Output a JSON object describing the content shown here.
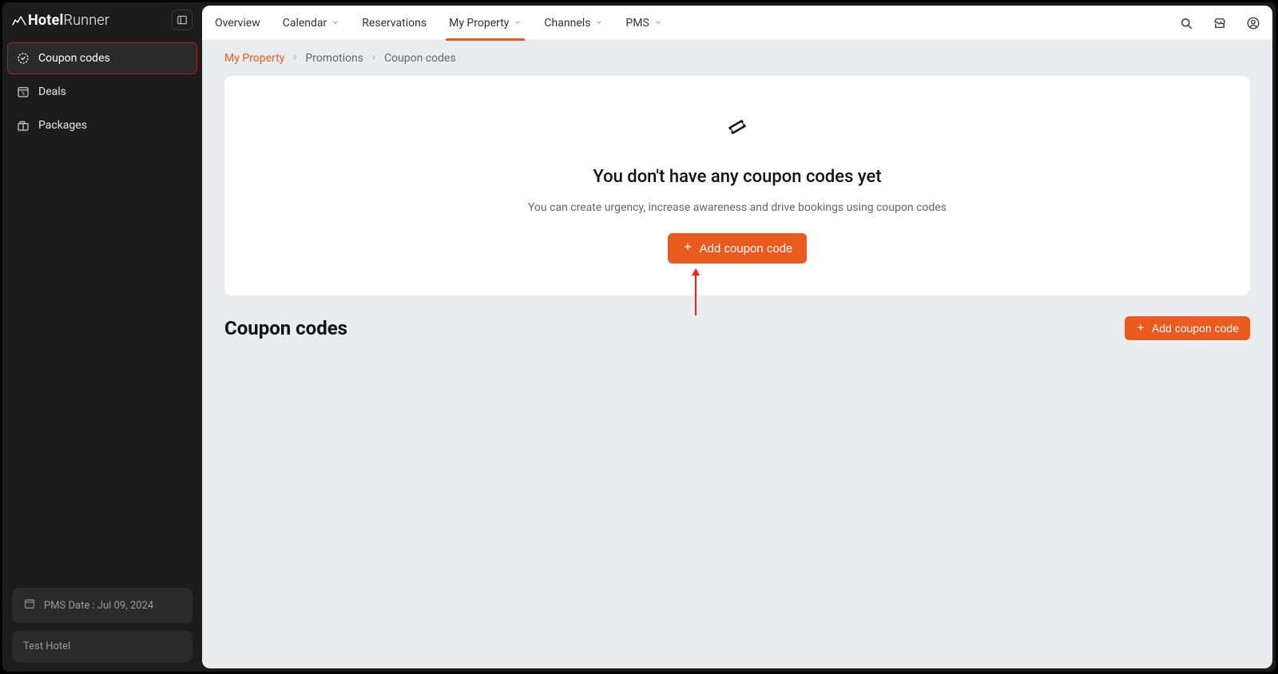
{
  "brand": {
    "name_a": "Hotel",
    "name_b": "Runner"
  },
  "sidebar": {
    "items": [
      {
        "label": "Coupon codes"
      },
      {
        "label": "Deals"
      },
      {
        "label": "Packages"
      }
    ]
  },
  "sidebar_footer": {
    "pms_date_label": "PMS Date : Jul 09, 2024",
    "hotel_name": "Test Hotel"
  },
  "topnav": {
    "items": [
      {
        "label": "Overview",
        "dropdown": false
      },
      {
        "label": "Calendar",
        "dropdown": true
      },
      {
        "label": "Reservations",
        "dropdown": false
      },
      {
        "label": "My Property",
        "dropdown": true,
        "active": true
      },
      {
        "label": "Channels",
        "dropdown": true
      },
      {
        "label": "PMS",
        "dropdown": true
      }
    ]
  },
  "breadcrumb": {
    "items": [
      {
        "label": "My Property",
        "link": true
      },
      {
        "label": "Promotions",
        "link": false
      },
      {
        "label": "Coupon codes",
        "link": false
      }
    ]
  },
  "empty_state": {
    "title": "You don't have any coupon codes yet",
    "subtitle": "You can create urgency, increase awareness and drive bookings using coupon codes",
    "cta": "Add coupon code"
  },
  "section": {
    "heading": "Coupon codes",
    "cta": "Add coupon code"
  }
}
